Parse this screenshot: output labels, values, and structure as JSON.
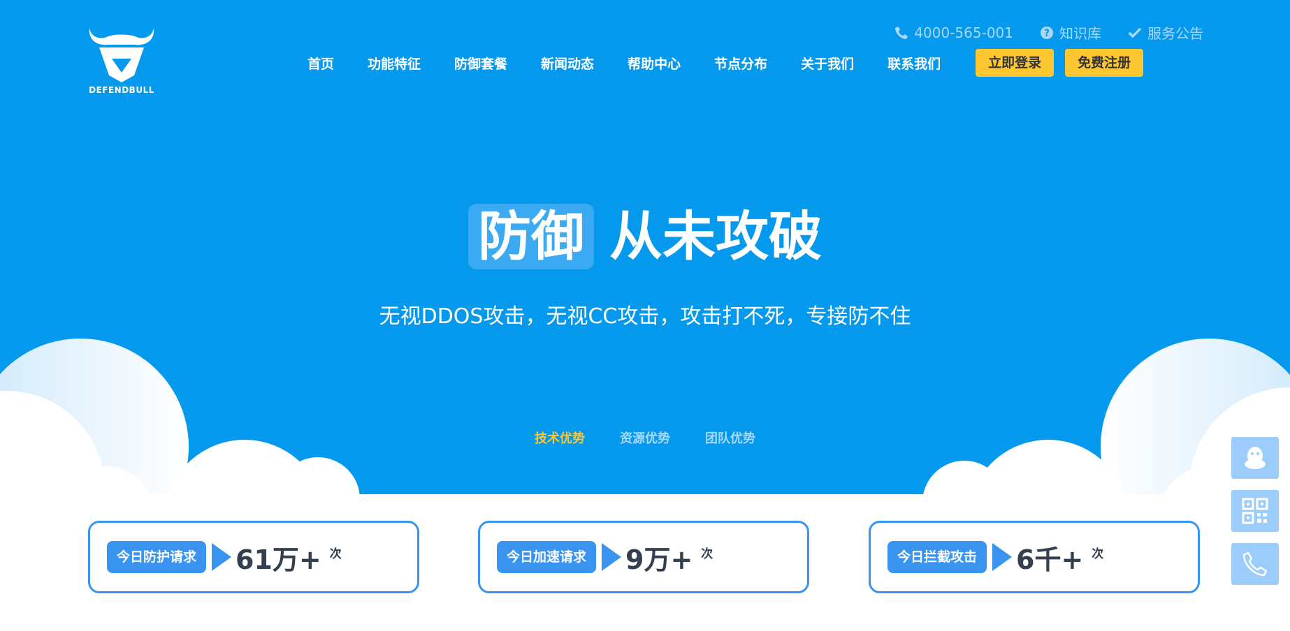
{
  "brand": {
    "name": "DEFENDBULL"
  },
  "topbar": {
    "phone": "4000-565-001",
    "knowledge": "知识库",
    "notice": "服务公告"
  },
  "nav": {
    "items": [
      "首页",
      "功能特征",
      "防御套餐",
      "新闻动态",
      "帮助中心",
      "节点分布",
      "关于我们",
      "联系我们"
    ],
    "login": "立即登录",
    "register": "免费注册"
  },
  "hero": {
    "highlight": "防御",
    "title_rest": "从未攻破",
    "subtitle": "无视DDOS攻击，无视CC攻击，攻击打不死，专接防不住"
  },
  "tabs": [
    {
      "label": "技术优势",
      "active": true
    },
    {
      "label": "资源优势",
      "active": false
    },
    {
      "label": "团队优势",
      "active": false
    }
  ],
  "stats": [
    {
      "label": "今日防护请求",
      "value": "61万+",
      "unit": "次"
    },
    {
      "label": "今日加速请求",
      "value": "9万+",
      "unit": "次"
    },
    {
      "label": "今日拦截攻击",
      "value": "6千+",
      "unit": "次"
    }
  ],
  "floating": [
    "qq-icon",
    "qrcode-icon",
    "phone-icon"
  ],
  "colors": {
    "hero_bg": "#0599ee",
    "accent": "#fcc730",
    "stat_border": "#3894ee"
  }
}
